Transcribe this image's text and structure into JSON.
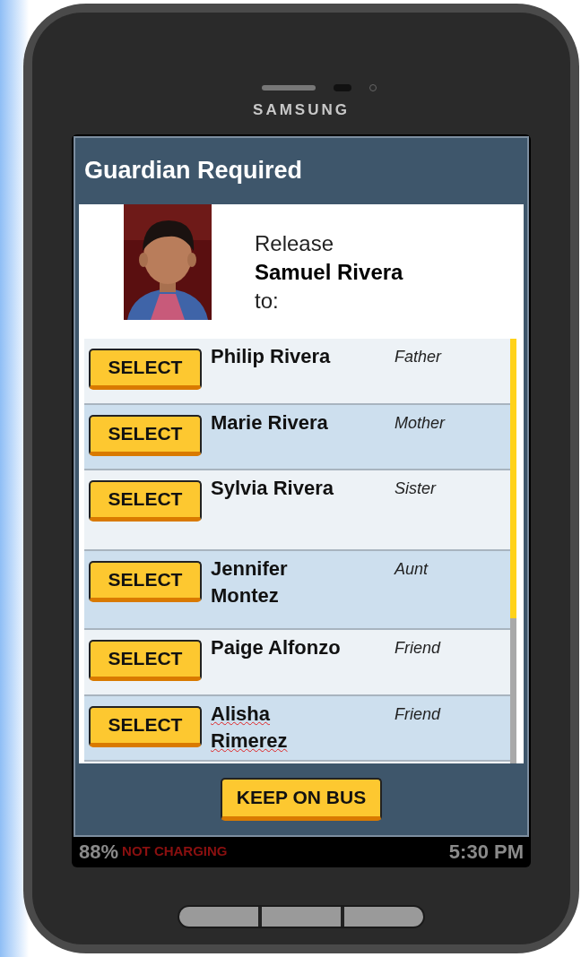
{
  "device": {
    "brand": "SAMSUNG"
  },
  "screen": {
    "title": "Guardian Required",
    "student": {
      "kind": "picture",
      "label_before": "Release",
      "name": "Samuel Rivera",
      "label_after": "to:"
    },
    "guardians": [
      {
        "button": "SELECT",
        "name": "Philip Rivera",
        "relation": "Father",
        "spell_flagged": false
      },
      {
        "button": "SELECT",
        "name": "Marie Rivera",
        "relation": "Mother",
        "spell_flagged": false
      },
      {
        "button": "SELECT",
        "name": "Sylvia Rivera",
        "relation": "Sister",
        "spell_flagged": false
      },
      {
        "button": "SELECT",
        "name": "Jennifer Montez",
        "relation": "Aunt",
        "spell_flagged": false
      },
      {
        "button": "SELECT",
        "name": "Paige Alfonzo",
        "relation": "Friend",
        "spell_flagged": false
      },
      {
        "button": "SELECT",
        "name": "Alisha Rimerez",
        "relation": "Friend",
        "spell_flagged": true
      }
    ],
    "keep_button": "KEEP ON BUS"
  },
  "status_bar": {
    "battery": "88%",
    "charging": "NOT CHARGING",
    "time": "5:30 PM"
  }
}
